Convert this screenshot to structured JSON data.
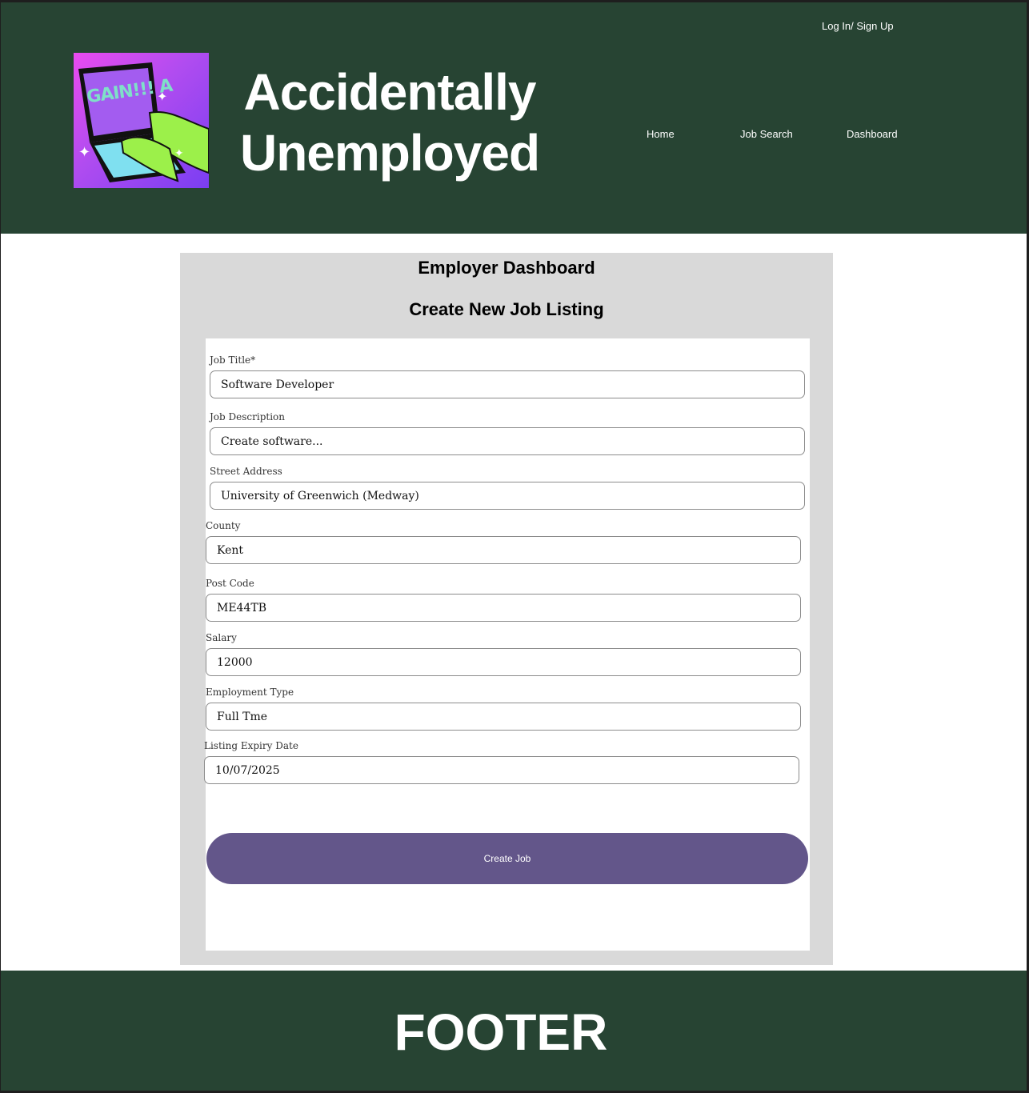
{
  "header": {
    "site_title_line1": "Accidentally",
    "site_title_line2": "Unemployed",
    "login_label": "Log In/ Sign Up",
    "nav": {
      "home": "Home",
      "job_search": "Job Search",
      "dashboard": "Dashboard"
    },
    "logo": {
      "screen_text": "GAIN!!! A"
    }
  },
  "main": {
    "heading": "Employer Dashboard",
    "subheading": "Create New Job Listing",
    "form": {
      "job_title": {
        "label": "Job Title*",
        "value": "Software Developer"
      },
      "job_description": {
        "label": "Job Description",
        "value": "Create software..."
      },
      "street_address": {
        "label": "Street Address",
        "value": "University  of Greenwich (Medway)"
      },
      "county": {
        "label": "County",
        "value": "Kent"
      },
      "post_code": {
        "label": "Post Code",
        "value": "ME44TB"
      },
      "salary": {
        "label": "Salary",
        "value": "12000"
      },
      "employment_type": {
        "label": "Employment Type",
        "value": "Full Tme"
      },
      "listing_expiry_date": {
        "label": "Listing Expiry Date",
        "value": "10/07/2025"
      },
      "submit_label": "Create Job"
    }
  },
  "footer": {
    "text": "FOOTER"
  },
  "colors": {
    "header_bg": "#274433",
    "button_bg": "#63568a",
    "card_bg": "#d9d9d9"
  }
}
